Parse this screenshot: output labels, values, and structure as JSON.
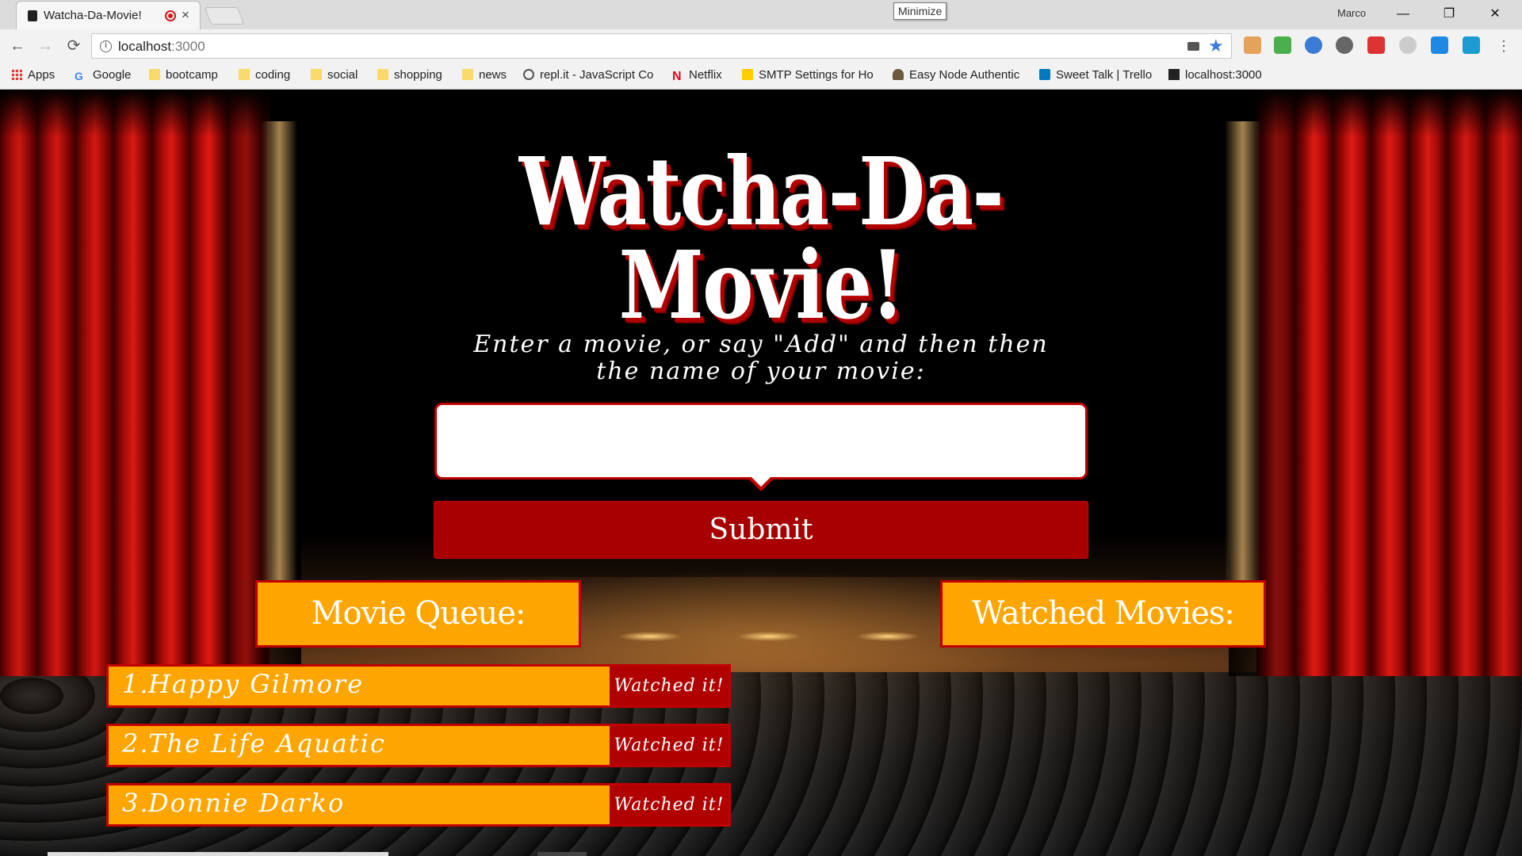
{
  "browser": {
    "tab_title": "Watcha-Da-Movie!",
    "tab_close": "×",
    "profile_name": "Marco",
    "minimize_symbol": "—",
    "restore_symbol": "❐",
    "close_symbol": "✕",
    "back_symbol": "←",
    "forward_symbol": "→",
    "reload_symbol": "⟳",
    "url_host": "localhost",
    "url_port": ":3000",
    "tooltip": "Minimize",
    "bookmarks": [
      {
        "label": "Apps",
        "icon": "apps-grid-icon"
      },
      {
        "label": "Google",
        "icon": "google-icon"
      },
      {
        "label": "bootcamp",
        "icon": "folder-icon"
      },
      {
        "label": "coding",
        "icon": "folder-icon"
      },
      {
        "label": "social",
        "icon": "folder-icon"
      },
      {
        "label": "shopping",
        "icon": "folder-icon"
      },
      {
        "label": "news",
        "icon": "folder-icon"
      },
      {
        "label": "repl.it - JavaScript Co",
        "icon": "replit-icon"
      },
      {
        "label": "Netflix",
        "icon": "netflix-icon"
      },
      {
        "label": "SMTP Settings for Ho",
        "icon": "smtp-icon"
      },
      {
        "label": "Easy Node Authentic",
        "icon": "node-auth-icon"
      },
      {
        "label": "Sweet Talk | Trello",
        "icon": "trello-icon"
      },
      {
        "label": "localhost:3000",
        "icon": "localhost-icon"
      }
    ]
  },
  "app": {
    "title": "Watcha-Da-Movie!",
    "prompt_line1": "Enter a movie, or say \"Add\" and then then",
    "prompt_line2": "the name of your movie:",
    "input_value": "",
    "submit_label": "Submit",
    "queue_heading": "Movie Queue:",
    "watched_heading": "Watched Movies:",
    "queue": [
      {
        "num": "1.",
        "title": "Happy Gilmore",
        "action": "Watched it!"
      },
      {
        "num": "2.",
        "title": "The Life Aquatic",
        "action": "Watched it!"
      },
      {
        "num": "3.",
        "title": "Donnie Darko",
        "action": "Watched it!"
      }
    ],
    "colors": {
      "accent_orange": "#ffa500",
      "accent_red": "#a80000",
      "border_red": "#c00000"
    }
  }
}
